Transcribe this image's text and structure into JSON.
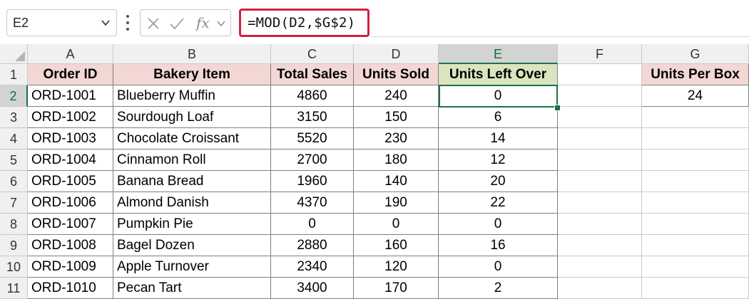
{
  "name_box": {
    "value": "E2"
  },
  "formula_bar": {
    "formula": "=MOD(D2,$G$2)",
    "fx_label": "fx"
  },
  "columns": [
    "A",
    "B",
    "C",
    "D",
    "E",
    "F",
    "G"
  ],
  "selected_column": "E",
  "selected_row": 2,
  "table": {
    "headers": [
      "Order ID",
      "Bakery Item",
      "Total Sales",
      "Units Sold",
      "Units Left Over"
    ],
    "rows": [
      [
        "ORD-1001",
        "Blueberry Muffin",
        "4860",
        "240",
        "0"
      ],
      [
        "ORD-1002",
        "Sourdough Loaf",
        "3150",
        "150",
        "6"
      ],
      [
        "ORD-1003",
        "Chocolate Croissant",
        "5520",
        "230",
        "14"
      ],
      [
        "ORD-1004",
        "Cinnamon Roll",
        "2700",
        "180",
        "12"
      ],
      [
        "ORD-1005",
        "Banana Bread",
        "1960",
        "140",
        "20"
      ],
      [
        "ORD-1006",
        "Almond Danish",
        "4370",
        "190",
        "22"
      ],
      [
        "ORD-1007",
        "Pumpkin Pie",
        "0",
        "0",
        "0"
      ],
      [
        "ORD-1008",
        "Bagel Dozen",
        "2880",
        "160",
        "16"
      ],
      [
        "ORD-1009",
        "Apple Turnover",
        "2340",
        "120",
        "0"
      ],
      [
        "ORD-1010",
        "Pecan Tart",
        "3400",
        "170",
        "2"
      ]
    ]
  },
  "side": {
    "header": "Units Per Box",
    "value": "24"
  },
  "colors": {
    "header_pink": "#f2d7d5",
    "header_green": "#d8e5be",
    "formula_border": "#d2233e",
    "selection": "#1e7145"
  }
}
